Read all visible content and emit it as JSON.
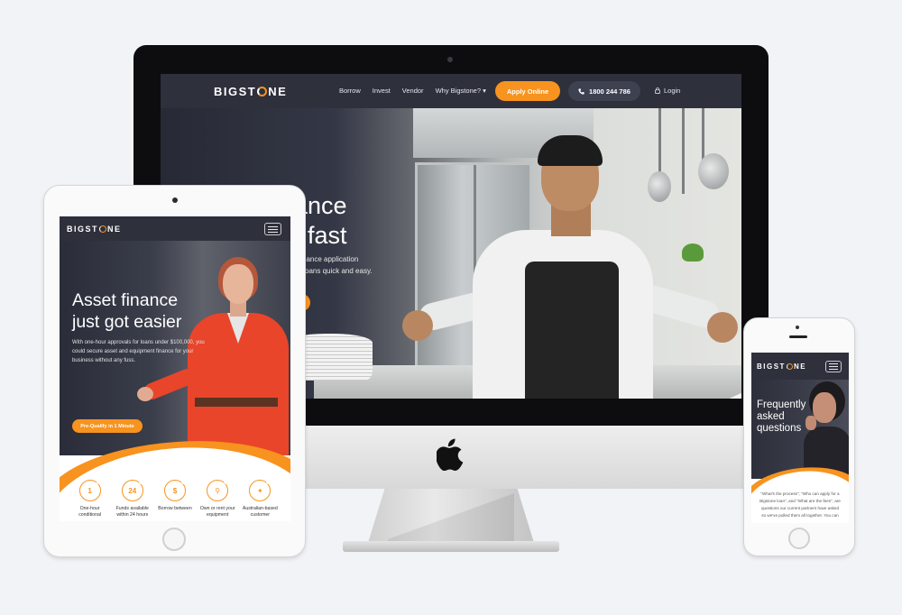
{
  "desktop": {
    "logo": {
      "pre": "BIGST",
      "post": "NE"
    },
    "nav": {
      "items": [
        "Borrow",
        "Invest",
        "Vendor",
        "Why Bigstone? ▾"
      ],
      "apply_label": "Apply Online",
      "phone": "1800 244 786",
      "login": "Login"
    },
    "hero": {
      "title_line1": "nance",
      "title_line2": "fast",
      "sub_line1": "ment finance application",
      "sub_line2": "oans quick and easy."
    }
  },
  "tablet": {
    "logo": {
      "pre": "BIGST",
      "post": "NE"
    },
    "hero": {
      "title": "Asset finance just got easier",
      "subtitle": "With one-hour approvals for loans under $100,000, you could secure asset and equipment finance for your business without any fuss.",
      "cta": "Pre-Qualify in 1 Minute"
    },
    "features": [
      {
        "icon": "1",
        "icon_name": "one-hour-icon",
        "label": "One-hour conditional"
      },
      {
        "icon": "24",
        "icon_name": "twenty-four-hours-icon",
        "label": "Funds available within 24 hours"
      },
      {
        "icon": "$",
        "icon_name": "dollar-icon",
        "label": "Borrow between"
      },
      {
        "icon": "⚲",
        "icon_name": "key-icon",
        "label": "Own or rent your equipment"
      },
      {
        "icon": "✦",
        "icon_name": "australia-map-icon",
        "label": "Australian-based customer"
      }
    ]
  },
  "mobile": {
    "logo": {
      "pre": "BIGST",
      "post": "NE"
    },
    "hero": {
      "title": "Frequently asked questions"
    },
    "body": "\"What's the process\", \"Who can apply for a Bigstone loan\", and \"What are the fees\", are questions our current partners have asked so we've pulled them all together. You can"
  },
  "colors": {
    "accent": "#f7931e",
    "nav": "#2e303c",
    "background": "#f1f3f6"
  }
}
